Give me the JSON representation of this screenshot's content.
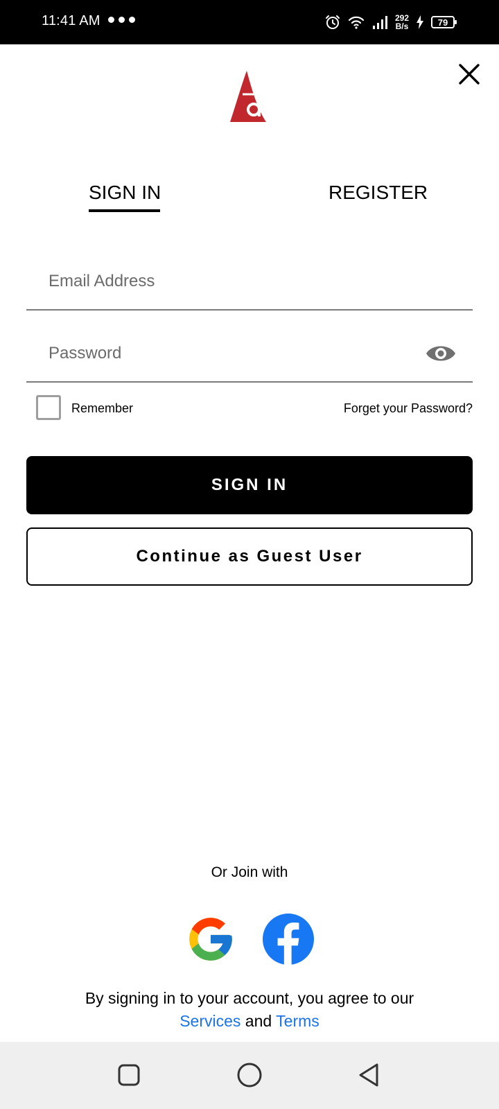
{
  "status_bar": {
    "time": "11:41 AM",
    "speed_value": "292",
    "speed_unit": "B/s",
    "battery": "79"
  },
  "header": {
    "logo_icon": "sail-logo-icon",
    "close_icon": "close-icon"
  },
  "tabs": [
    {
      "label": "SIGN IN",
      "active": true
    },
    {
      "label": "REGISTER",
      "active": false
    }
  ],
  "form": {
    "email_placeholder": "Email Address",
    "email_value": "",
    "password_placeholder": "Password",
    "password_value": "",
    "remember_label": "Remember",
    "remember_checked": false,
    "forgot_label": "Forget your Password?",
    "signin_label": "SIGN IN",
    "guest_label": "Continue as Guest User"
  },
  "social": {
    "or_join": "Or Join with",
    "providers": [
      "google-icon",
      "facebook-icon"
    ]
  },
  "terms": {
    "line1": "By signing in to your account, you agree to our",
    "services_link": "Services",
    "and": "and",
    "terms_link": "Terms"
  },
  "colors": {
    "brand_red": "#c0282d",
    "link_blue": "#1a73e8",
    "facebook_blue": "#1877f2"
  }
}
